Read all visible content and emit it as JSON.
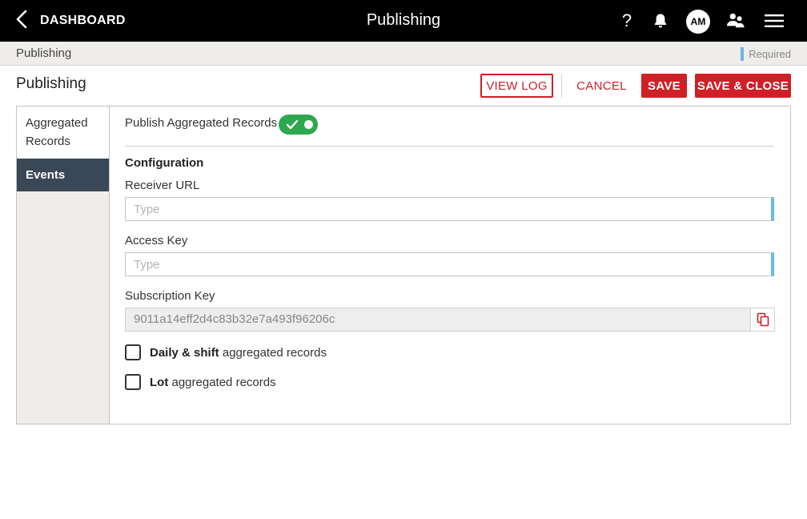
{
  "header": {
    "back_label": "DASHBOARD",
    "title": "Publishing",
    "help_glyph": "?",
    "avatar_initials": "AM",
    "icons": [
      "chevron-left-icon",
      "help-icon",
      "bell-icon",
      "users-icon",
      "menu-icon"
    ]
  },
  "breadcrumb": {
    "current": "Publishing",
    "required_label": "Required"
  },
  "page": {
    "title": "Publishing"
  },
  "actions": {
    "view_log": "VIEW LOG",
    "cancel": "CANCEL",
    "save": "SAVE",
    "save_close": "SAVE & CLOSE"
  },
  "sidebar": {
    "items": [
      {
        "label": "Aggregated Records",
        "active": false
      },
      {
        "label": "Events",
        "active": true
      }
    ]
  },
  "form": {
    "publish_label": "Publish Aggregated Records",
    "publish_enabled": true,
    "section_title": "Configuration",
    "receiver_url": {
      "label": "Receiver URL",
      "value": "",
      "placeholder": "Type"
    },
    "access_key": {
      "label": "Access Key",
      "value": "",
      "placeholder": "Type"
    },
    "subscription_key": {
      "label": "Subscription Key",
      "value": "9011a14eff2d4c83b32e7a493f96206c"
    },
    "checkboxes": [
      {
        "bold": "Daily & shift",
        "rest": "aggregated records",
        "checked": false
      },
      {
        "bold": "Lot",
        "rest": "aggregated records",
        "checked": false
      }
    ]
  },
  "colors": {
    "brand_red": "#d01f27",
    "toggle_green": "#2ea84f",
    "nav_active": "#3a4756",
    "required_blue": "#6db8e3"
  }
}
